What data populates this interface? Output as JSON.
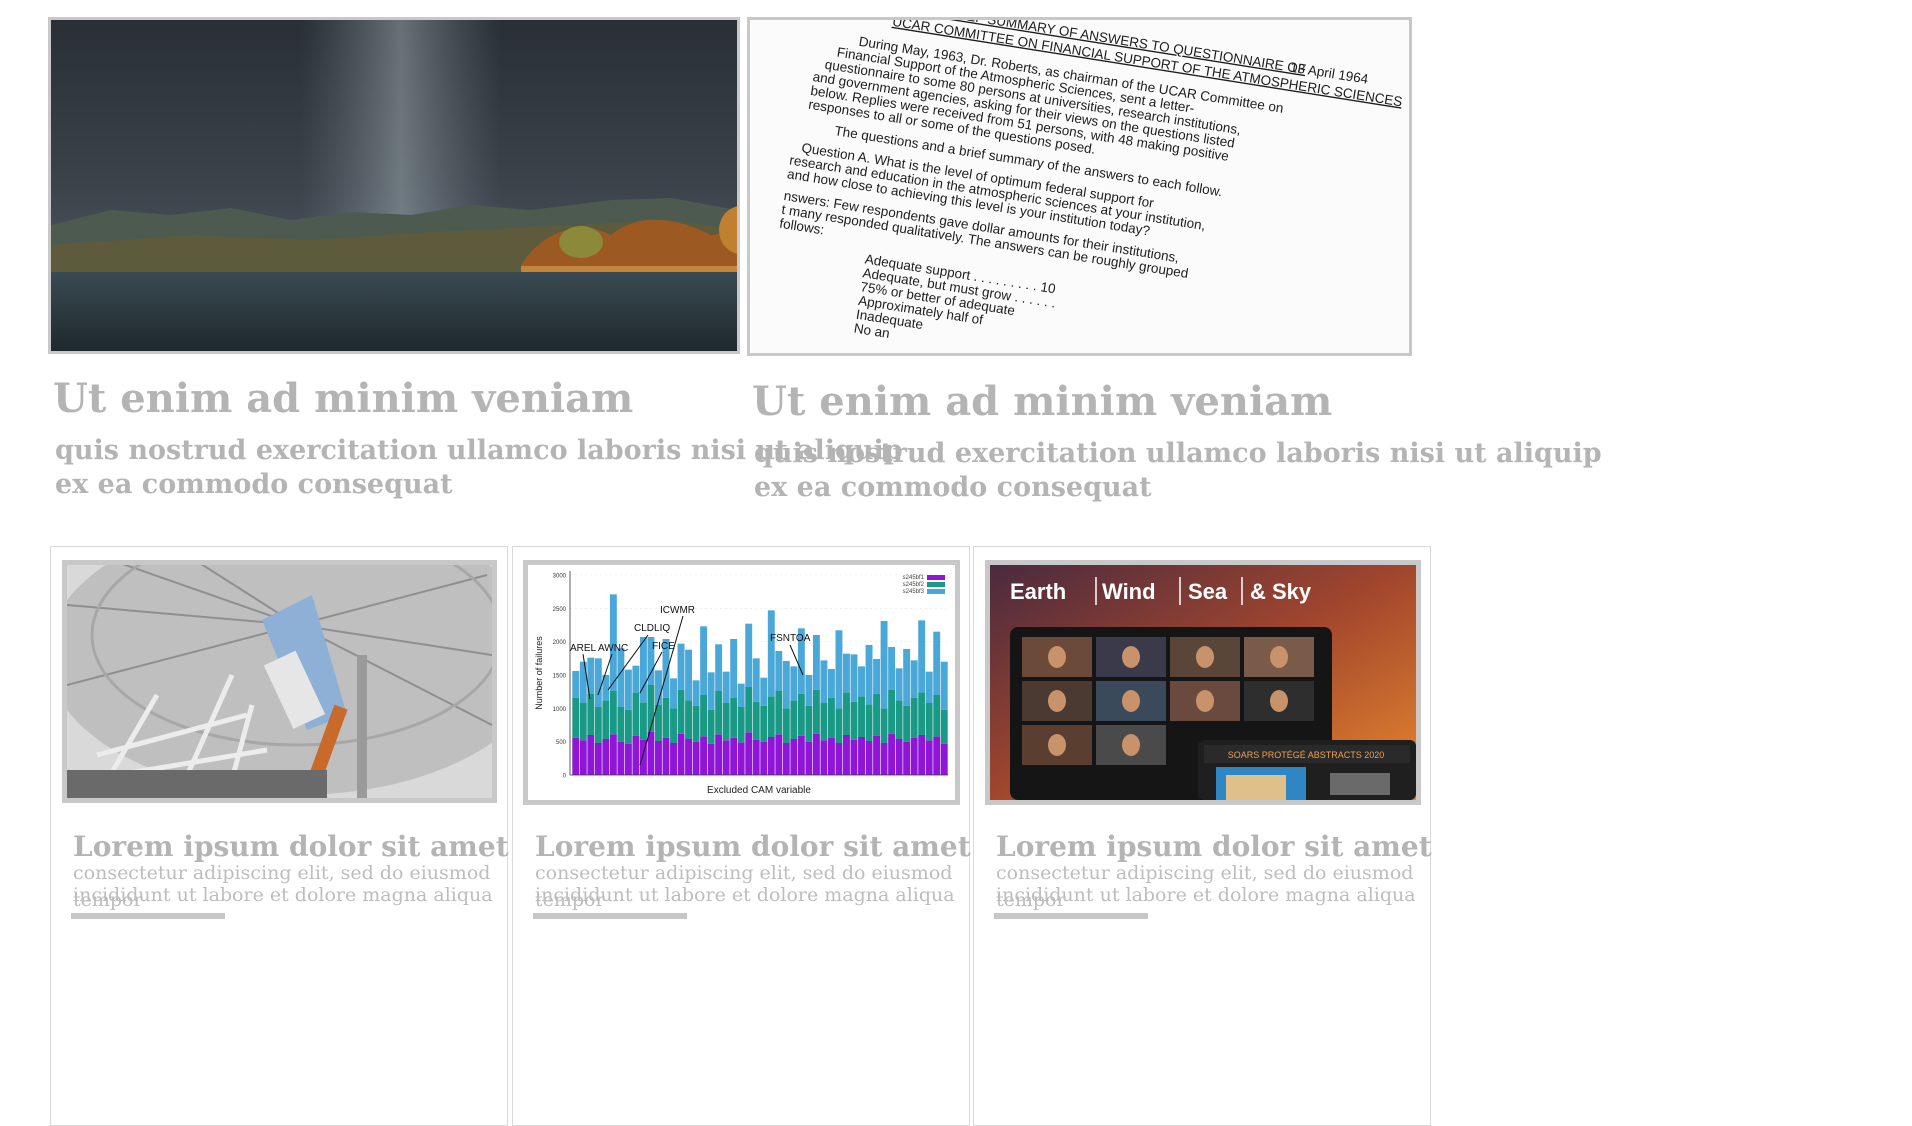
{
  "features": [
    {
      "title": "Ut enim ad minim veniam",
      "subtitle_line1": "quis nostrud exercitation ullamco laboris nisi ut aliquip",
      "subtitle_line2": "ex ea commodo consequat"
    },
    {
      "title": "Ut enim ad minim veniam",
      "subtitle_line1": "quis nostrud exercitation ullamco laboris nisi ut aliquip",
      "subtitle_line2": "ex ea commodo consequat"
    }
  ],
  "document": {
    "date": "13 April 1964",
    "heading1": "BRIEF SUMMARY OF ANSWERS TO QUESTIONNAIRE OF",
    "heading2": "UCAR COMMITTEE ON FINANCIAL SUPPORT OF THE ATMOSPHERIC SCIENCES",
    "lines": [
      "During May, 1963, Dr. Roberts, as chairman of the UCAR Committee on",
      "Financial Support of the Atmospheric Sciences, sent a letter-",
      "questionnaire to some 80 persons at universities, research institutions,",
      "and government agencies, asking for their views on the questions listed",
      "below.  Replies were received from 51 persons, with 48 making positive",
      "responses to all or some of the questions posed.",
      "The questions and a brief summary of the answers to each follow.",
      "Question A.    What is the level of optimum federal support for",
      "research and education in the atmospheric sciences at your institution,",
      "and how close to achieving this level is your institution today?",
      "nswers:  Few respondents gave dollar amounts for their institutions,",
      "t many responded qualitatively.  The answers can be roughly grouped",
      "follows:",
      "Adequate support . . . . . . . . . 10",
      "Adequate, but must grow . . . . . .",
      "75% or better of adequate",
      "Approximately half of",
      "Inadequate",
      "No an"
    ]
  },
  "cards": [
    {
      "title": "Lorem ipsum dolor sit amet",
      "body_line1": "consectetur adipiscing elit, sed do eiusmod tempor",
      "body_line2": "incididunt ut labore et dolore magna aliqua"
    },
    {
      "title": "Lorem ipsum dolor sit amet",
      "body_line1": "consectetur adipiscing elit, sed do eiusmod tempor",
      "body_line2": "incididunt ut labore et dolore magna aliqua"
    },
    {
      "title": "Lorem ipsum dolor sit amet",
      "body_line1": "consectetur adipiscing elit, sed do eiusmod tempor",
      "body_line2": "incididunt ut labore et dolore magna aliqua"
    }
  ],
  "chart": {
    "xlabel": "Excluded CAM variable",
    "ylabel": "Number of failures",
    "yticks": [
      "0",
      "500",
      "1000",
      "1500",
      "2000",
      "2500",
      "3000"
    ],
    "legend": [
      "s245bf1",
      "s245bf2",
      "s245bf3"
    ],
    "annotations": [
      "AREL",
      "AWNC",
      "CLDLIQ",
      "ICWMR",
      "FICE",
      "FSNTOA"
    ]
  },
  "chart_data": {
    "type": "bar",
    "stacked": true,
    "xlabel": "Excluded CAM variable",
    "ylabel": "Number of failures",
    "ylim": [
      0,
      3000
    ],
    "colors": [
      "#8f16d6",
      "#1a9a86",
      "#4aa8d8"
    ],
    "series": [
      {
        "name": "s245bf1",
        "values": [
          560,
          520,
          600,
          480,
          540,
          610,
          500,
          470,
          590,
          530,
          650,
          510,
          560,
          480,
          620,
          540,
          500,
          580,
          470,
          610,
          520,
          560,
          490,
          640,
          530,
          500,
          570,
          610,
          480,
          540,
          590,
          500,
          620,
          520,
          560,
          480,
          600,
          530,
          570,
          510,
          590,
          480,
          620,
          540,
          500,
          560,
          600,
          520,
          580,
          470
        ]
      },
      {
        "name": "s245bf2",
        "values": [
          600,
          560,
          620,
          540,
          580,
          650,
          520,
          510,
          640,
          560,
          700,
          540,
          600,
          520,
          660,
          580,
          540,
          620,
          510,
          650,
          560,
          600,
          530,
          680,
          570,
          540,
          610,
          650,
          520,
          580,
          630,
          540,
          660,
          560,
          600,
          520,
          640,
          570,
          610,
          550,
          630,
          520,
          660,
          580,
          540,
          600,
          640,
          560,
          620,
          510
        ]
      },
      {
        "name": "s245bf3",
        "values": [
          400,
          620,
          540,
          730,
          380,
          1450,
          880,
          600,
          410,
          980,
          720,
          520,
          880,
          450,
          690,
          760,
          380,
          1030,
          560,
          700,
          470,
          880,
          350,
          950,
          650,
          420,
          1290,
          600,
          710,
          510,
          980,
          460,
          820,
          640,
          430,
          1170,
          580,
          710,
          450,
          890,
          520,
          1310,
          640,
          480,
          850,
          560,
          1080,
          470,
          950,
          720
        ]
      }
    ]
  }
}
